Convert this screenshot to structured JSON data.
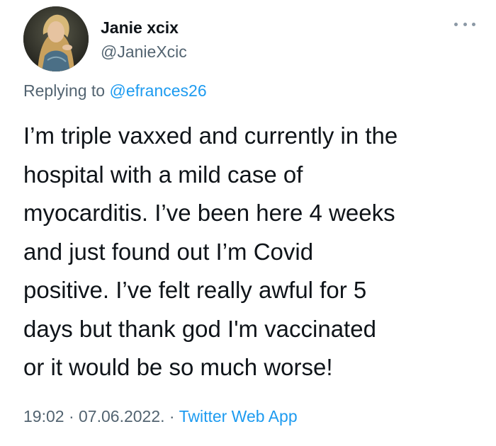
{
  "author": {
    "display_name": "Janie xcix",
    "handle": "@JanieXcic"
  },
  "reply": {
    "prefix": "Replying to ",
    "mention": "@efrances26"
  },
  "tweet": {
    "lines": [
      "I’m triple vaxxed and currently in the",
      "hospital with a mild case of",
      "myocarditis. I’ve been here 4 weeks",
      "and just found out I’m Covid",
      "positive. I’ve felt really awful for 5",
      "days but thank god I'm vaccinated",
      "or it would be so much worse!"
    ]
  },
  "meta": {
    "time": "19:02",
    "separator1": " · ",
    "date": "07.06.2022.",
    "separator2": " · ",
    "app": "Twitter Web App"
  },
  "icons": {
    "more": "more-horizontal-icon"
  },
  "colors": {
    "text": "#0f1419",
    "secondary": "#536471",
    "link": "#1d9bf0"
  }
}
